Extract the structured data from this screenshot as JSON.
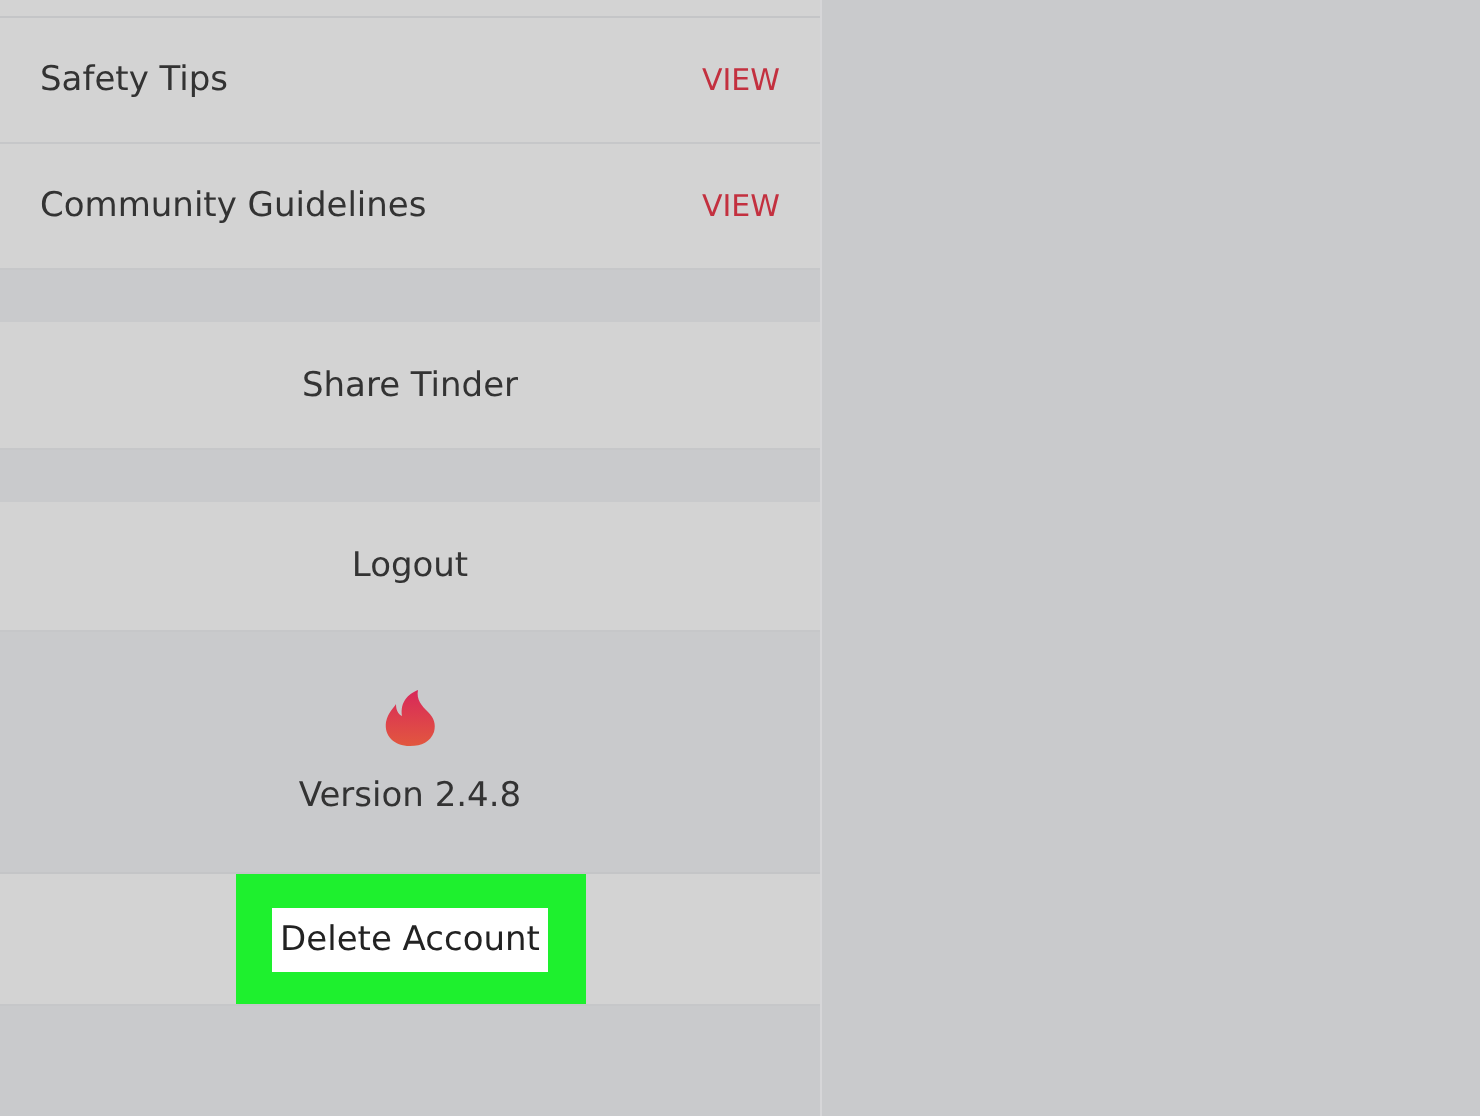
{
  "links": [
    {
      "label": "Safety Tips",
      "action": "VIEW"
    },
    {
      "label": "Community Guidelines",
      "action": "VIEW"
    }
  ],
  "share": {
    "label": "Share Tinder"
  },
  "logout": {
    "label": "Logout"
  },
  "version": {
    "text": "Version 2.4.8"
  },
  "delete_account": {
    "label": "Delete Account",
    "highlighted": true
  }
}
